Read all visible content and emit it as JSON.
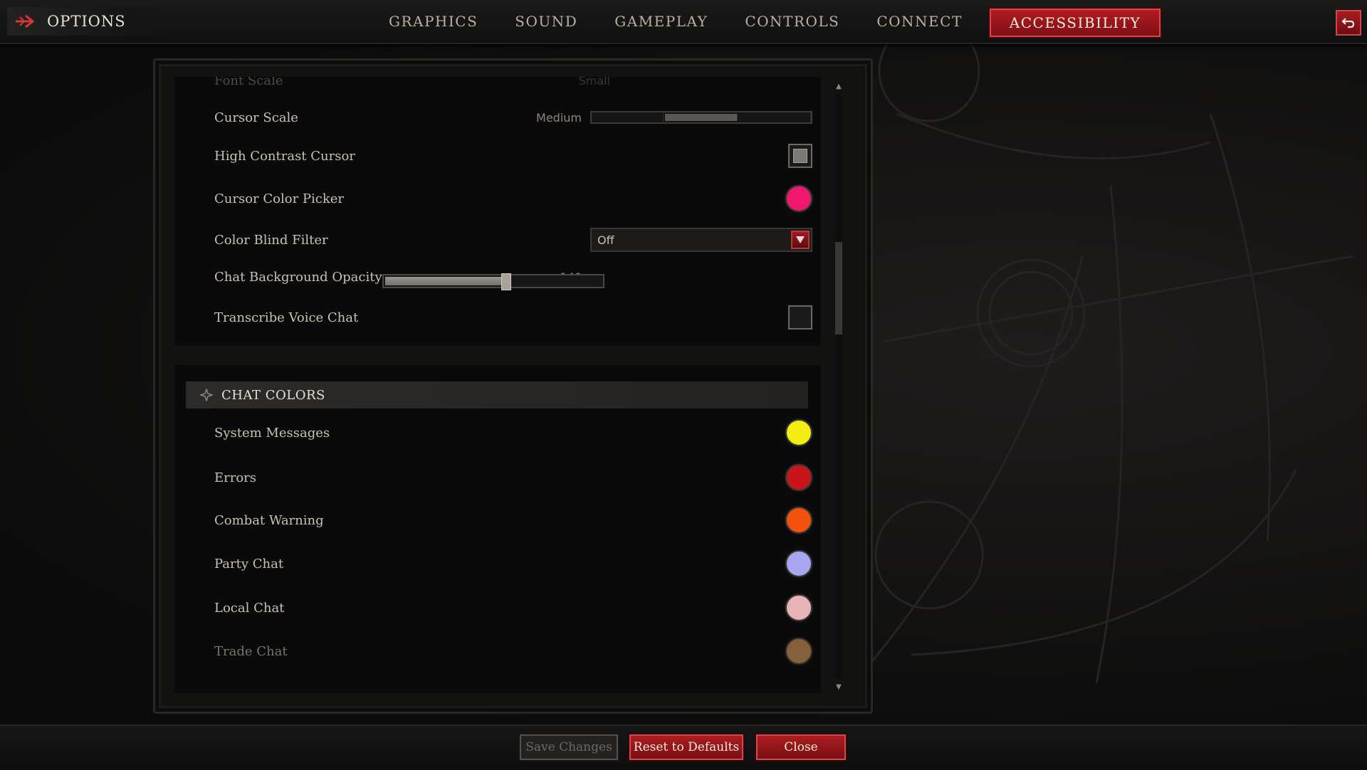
{
  "header": {
    "title": "OPTIONS",
    "tabs": [
      {
        "label": "GRAPHICS"
      },
      {
        "label": "SOUND"
      },
      {
        "label": "GAMEPLAY"
      },
      {
        "label": "CONTROLS"
      },
      {
        "label": "CONNECT"
      },
      {
        "label": "ACCESSIBILITY",
        "active": true
      }
    ]
  },
  "settings": {
    "font_scale": {
      "label": "Font Scale",
      "value": "Small"
    },
    "cursor_scale": {
      "label": "Cursor Scale",
      "value": "Medium",
      "selected_segment": 2,
      "segments": 3
    },
    "high_contrast_cursor": {
      "label": "High Contrast Cursor",
      "checked": true
    },
    "cursor_color_picker": {
      "label": "Cursor Color Picker",
      "color": "#f0186e"
    },
    "color_blind_filter": {
      "label": "Color Blind Filter",
      "value": "Off"
    },
    "chat_background_opacity": {
      "label": "Chat Background Opacity",
      "value": "140",
      "fraction": 0.55
    },
    "transcribe_voice_chat": {
      "label": "Transcribe Voice Chat",
      "checked": false
    }
  },
  "chat_colors": {
    "title": "CHAT COLORS",
    "items": [
      {
        "label": "System Messages",
        "color": "#f2ee14"
      },
      {
        "label": "Errors",
        "color": "#c8141a"
      },
      {
        "label": "Combat Warning",
        "color": "#f2520d"
      },
      {
        "label": "Party Chat",
        "color": "#a8a6f0"
      },
      {
        "label": "Local Chat",
        "color": "#e8b3b6"
      },
      {
        "label": "Trade Chat",
        "color": "#9b7044"
      }
    ]
  },
  "footer": {
    "save_label": "Save Changes",
    "reset_label": "Reset to Defaults",
    "close_label": "Close"
  },
  "icons": [
    "arrow-icon",
    "back-icon",
    "dropdown-arrow-icon",
    "section-gem-icon",
    "scroll-up-icon",
    "scroll-down-icon"
  ]
}
